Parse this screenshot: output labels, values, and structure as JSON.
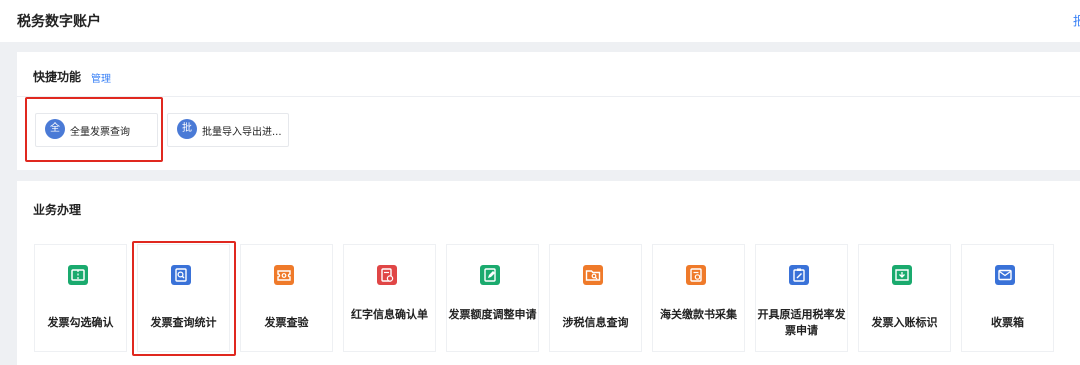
{
  "header": {
    "title": "税务数字账户",
    "right_text": "报"
  },
  "quick": {
    "title": "快捷功能",
    "manage": "管理",
    "items": [
      {
        "badge": "全",
        "label": "全量发票查询"
      },
      {
        "badge": "批",
        "label": "批量导入导出进..."
      }
    ]
  },
  "business": {
    "title": "业务办理",
    "items": [
      {
        "label": "发票勾选确认",
        "icon": "ticket-icon",
        "color": "#1aaa6e"
      },
      {
        "label": "发票查询统计",
        "icon": "search-doc-icon",
        "color": "#3a72d8"
      },
      {
        "label": "发票查验",
        "icon": "ticket-verify-icon",
        "color": "#ef7a2a"
      },
      {
        "label": "红字信息确认单",
        "icon": "doc-stamp-icon",
        "color": "#e04646"
      },
      {
        "label": "发票额度调整申请",
        "icon": "doc-edit-icon",
        "color": "#1aaa6e"
      },
      {
        "label": "涉税信息查询",
        "icon": "folder-search-icon",
        "color": "#ef7a2a"
      },
      {
        "label": "海关缴款书采集",
        "icon": "doc-download-icon",
        "color": "#ef7a2a"
      },
      {
        "label": "开具原适用税率发票申请",
        "icon": "clipboard-edit-icon",
        "color": "#3a72d8"
      },
      {
        "label": "发票入账标识",
        "icon": "inbox-icon",
        "color": "#1aaa6e"
      },
      {
        "label": "收票箱",
        "icon": "mail-icon",
        "color": "#3a72d8"
      }
    ]
  }
}
